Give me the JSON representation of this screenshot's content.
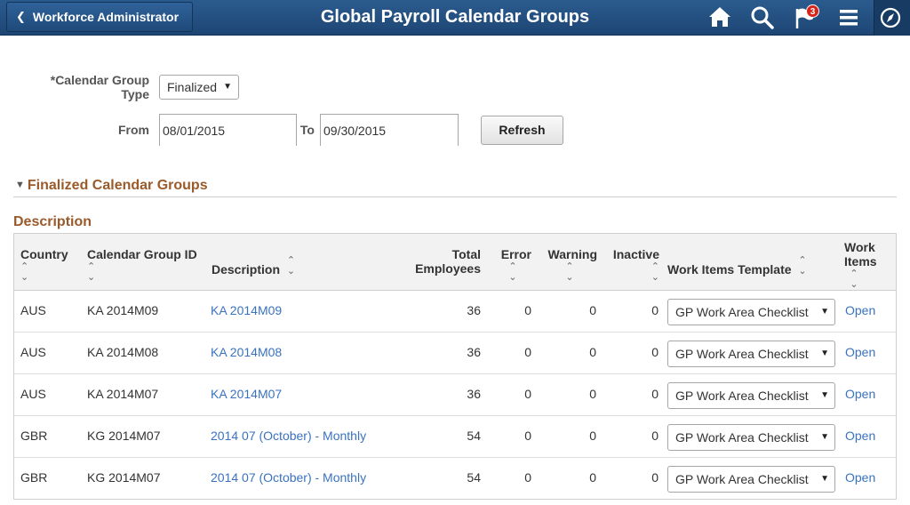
{
  "header": {
    "back_label": "Workforce Administrator",
    "title": "Global Payroll Calendar Groups",
    "notification_count": "3",
    "icons": [
      "chevron-left-icon",
      "home-icon",
      "search-icon",
      "flag-icon",
      "menu-icon",
      "compass-icon"
    ]
  },
  "form": {
    "calendar_group_type_label": "*Calendar Group Type",
    "calendar_group_type_value": "Finalized",
    "from_label": "From",
    "from_value": "08/01/2015",
    "to_label": "To",
    "to_value": "09/30/2015",
    "refresh_label": "Refresh"
  },
  "section": {
    "title": "Finalized Calendar Groups",
    "grid_title": "Description"
  },
  "grid": {
    "columns": {
      "country": "Country",
      "calendar_group_id": "Calendar Group ID",
      "description": "Description",
      "total_employees": "Total Employees",
      "error": "Error",
      "warning": "Warning",
      "inactive": "Inactive",
      "work_items_template": "Work Items Template",
      "work_items": "Work Items"
    },
    "rows": [
      {
        "country": "AUS",
        "id": "KA 2014M09",
        "description": "KA 2014M09",
        "total": "36",
        "error": "0",
        "warning": "0",
        "inactive": "0",
        "template": "GP Work Area Checklist",
        "work_items": "Open"
      },
      {
        "country": "AUS",
        "id": "KA 2014M08",
        "description": "KA 2014M08",
        "total": "36",
        "error": "0",
        "warning": "0",
        "inactive": "0",
        "template": "GP Work Area Checklist",
        "work_items": "Open"
      },
      {
        "country": "AUS",
        "id": "KA 2014M07",
        "description": "KA 2014M07",
        "total": "36",
        "error": "0",
        "warning": "0",
        "inactive": "0",
        "template": "GP Work Area Checklist",
        "work_items": "Open"
      },
      {
        "country": "GBR",
        "id": "KG 2014M07",
        "description": "2014 07 (October) - Monthly",
        "total": "54",
        "error": "0",
        "warning": "0",
        "inactive": "0",
        "template": "GP Work Area Checklist",
        "work_items": "Open"
      },
      {
        "country": "GBR",
        "id": "KG 2014M07",
        "description": "2014 07 (October) - Monthly",
        "total": "54",
        "error": "0",
        "warning": "0",
        "inactive": "0",
        "template": "GP Work Area Checklist",
        "work_items": "Open"
      }
    ]
  },
  "colors": {
    "header_blue": "#1d4674",
    "section_brown": "#9a5a2a",
    "link_blue": "#3a72c0",
    "badge_red": "#d9241b"
  }
}
